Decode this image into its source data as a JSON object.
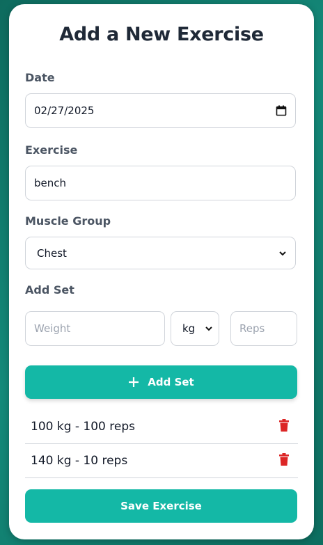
{
  "form": {
    "title": "Add a New Exercise",
    "date_label": "Date",
    "date_value": "02/27/2025",
    "exercise_label": "Exercise",
    "exercise_value": "bench",
    "muscle_label": "Muscle Group",
    "muscle_value": "Chest",
    "add_set_label": "Add Set",
    "weight_placeholder": "Weight",
    "unit_value": "kg",
    "reps_placeholder": "Reps",
    "add_set_button": "Add Set",
    "save_button": "Save Exercise"
  },
  "sets": [
    {
      "text": "100 kg - 100 reps"
    },
    {
      "text": "140 kg - 10 reps"
    }
  ],
  "colors": {
    "accent": "#14b8a6",
    "delete": "#dc2626",
    "background": "#0e6b5e"
  },
  "icons": {
    "calendar": "calendar-icon",
    "chevron": "chevron-down-icon",
    "plus": "plus-icon",
    "trash": "trash-icon"
  }
}
